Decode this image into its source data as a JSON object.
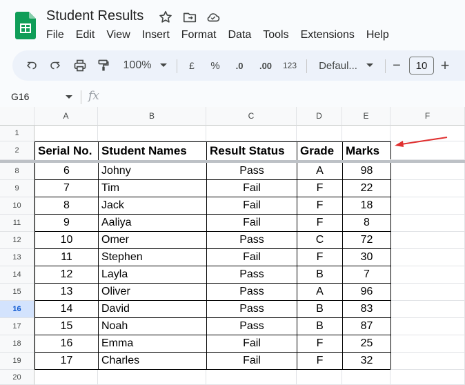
{
  "app": {
    "title": "Student Results",
    "menu": [
      "File",
      "Edit",
      "View",
      "Insert",
      "Format",
      "Data",
      "Tools",
      "Extensions",
      "Help"
    ]
  },
  "toolbar": {
    "zoom": "100%",
    "currency": "£",
    "percent": "%",
    "dec_decrease": ".0",
    "dec_increase": ".00",
    "number_format": "123",
    "font": "Defaul...",
    "font_size": "10",
    "minus": "−",
    "plus": "+"
  },
  "formula_bar": {
    "name_box": "G16",
    "fx": "fx"
  },
  "columns": [
    "A",
    "B",
    "C",
    "D",
    "E",
    "F"
  ],
  "header_row": {
    "row_num": "2",
    "cells": [
      "Serial No.",
      "Student Names",
      "Result Status",
      "Grade",
      "Marks"
    ]
  },
  "top_rows": [
    "1"
  ],
  "data_rows": [
    {
      "row": "8",
      "cells": [
        "6",
        "Johny",
        "Pass",
        "A",
        "98"
      ]
    },
    {
      "row": "9",
      "cells": [
        "7",
        "Tim",
        "Fail",
        "F",
        "22"
      ]
    },
    {
      "row": "10",
      "cells": [
        "8",
        "Jack",
        "Fail",
        "F",
        "18"
      ]
    },
    {
      "row": "11",
      "cells": [
        "9",
        "Aaliya",
        "Fail",
        "F",
        "8"
      ]
    },
    {
      "row": "12",
      "cells": [
        "10",
        "Omer",
        "Pass",
        "C",
        "72"
      ]
    },
    {
      "row": "13",
      "cells": [
        "11",
        "Stephen",
        "Fail",
        "F",
        "30"
      ]
    },
    {
      "row": "14",
      "cells": [
        "12",
        "Layla",
        "Pass",
        "B",
        "7"
      ]
    },
    {
      "row": "15",
      "cells": [
        "13",
        "Oliver",
        "Pass",
        "A",
        "96"
      ]
    },
    {
      "row": "16",
      "cells": [
        "14",
        "David",
        "Pass",
        "B",
        "83"
      ]
    },
    {
      "row": "17",
      "cells": [
        "15",
        "Noah",
        "Pass",
        "B",
        "87"
      ]
    },
    {
      "row": "18",
      "cells": [
        "16",
        "Emma",
        "Fail",
        "F",
        "25"
      ]
    },
    {
      "row": "19",
      "cells": [
        "17",
        "Charles",
        "Fail",
        "F",
        "32"
      ]
    }
  ],
  "bottom_rows": [
    "20"
  ],
  "selected_row": "16",
  "colors": {
    "arrow": "#e03030",
    "selected_header": "#d3e3fd",
    "logo": "#0f9d58"
  }
}
